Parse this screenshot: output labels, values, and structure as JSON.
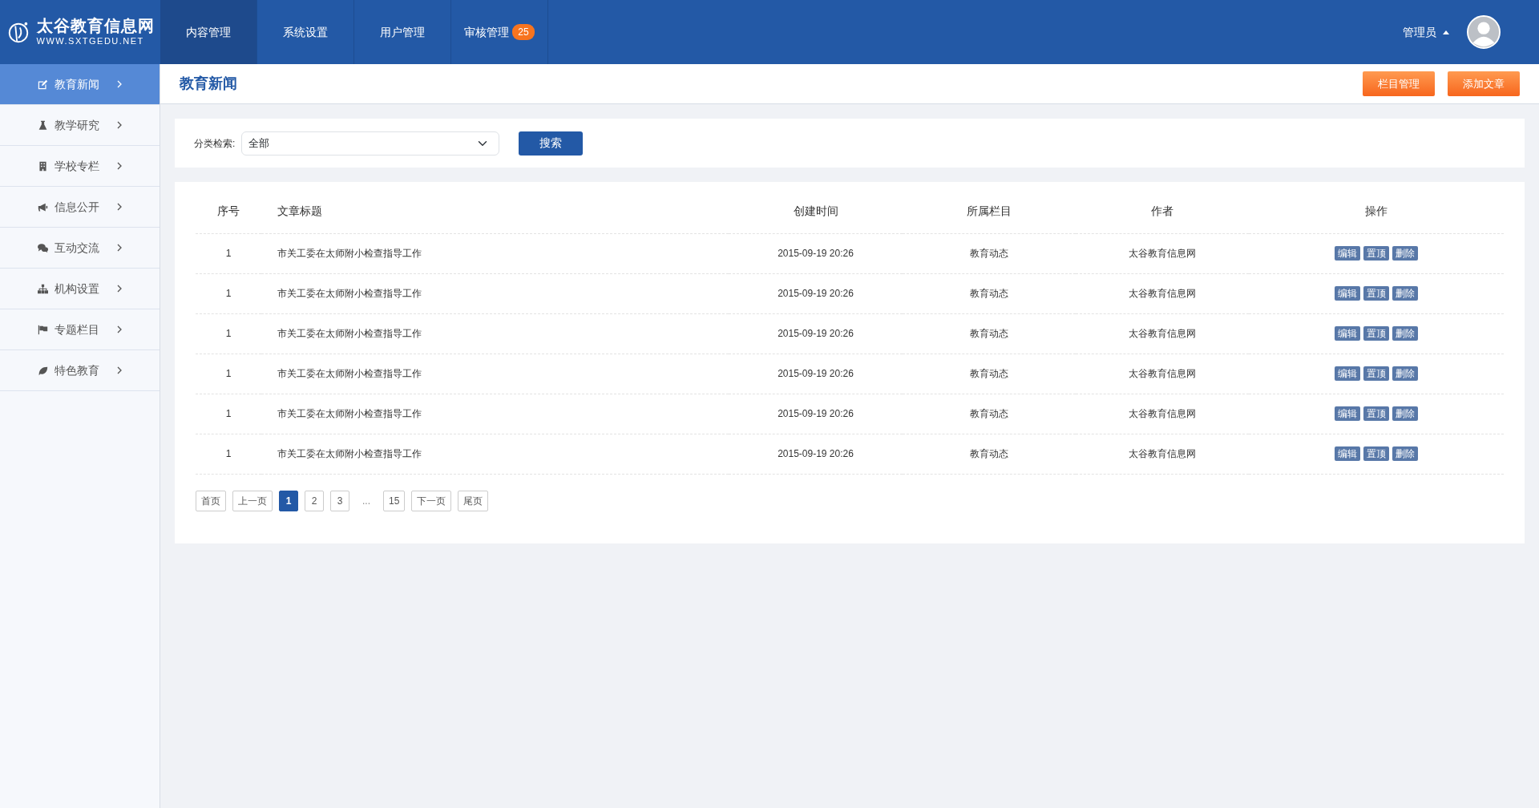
{
  "logo": {
    "title": "太谷教育信息网",
    "subtitle": "WWW.SXTGEDU.NET"
  },
  "top_nav": [
    {
      "label": "内容管理",
      "selected": true
    },
    {
      "label": "系统设置",
      "selected": false
    },
    {
      "label": "用户管理",
      "selected": false
    },
    {
      "label": "审核管理",
      "selected": false,
      "badge": "25"
    }
  ],
  "user": {
    "name": "管理员"
  },
  "sidebar": {
    "items": [
      {
        "label": "教育新闻",
        "selected": true
      },
      {
        "label": "教学研究",
        "selected": false
      },
      {
        "label": "学校专栏",
        "selected": false
      },
      {
        "label": "信息公开",
        "selected": false
      },
      {
        "label": "互动交流",
        "selected": false
      },
      {
        "label": "机构设置",
        "selected": false
      },
      {
        "label": "专题栏目",
        "selected": false
      },
      {
        "label": "特色教育",
        "selected": false
      }
    ]
  },
  "page": {
    "title": "教育新闻",
    "buttons": [
      "栏目管理",
      "添加文章"
    ]
  },
  "filter": {
    "label": "分类检索:",
    "value": "全部",
    "button": "搜索"
  },
  "table": {
    "columns": [
      "序号",
      "文章标题",
      "创建时间",
      "所属栏目",
      "作者",
      "操作"
    ],
    "rows": [
      {
        "cells": [
          "1",
          "市关工委在太师附小检查指导工作",
          "2015-09-19 20:26",
          "教育动态",
          "太谷教育信息网"
        ],
        "actions": [
          "编辑",
          "置顶",
          "删除"
        ]
      },
      {
        "cells": [
          "1",
          "市关工委在太师附小检查指导工作",
          "2015-09-19 20:26",
          "教育动态",
          "太谷教育信息网"
        ],
        "actions": [
          "编辑",
          "置顶",
          "删除"
        ]
      },
      {
        "cells": [
          "1",
          "市关工委在太师附小检查指导工作",
          "2015-09-19 20:26",
          "教育动态",
          "太谷教育信息网"
        ],
        "actions": [
          "编辑",
          "置顶",
          "删除"
        ]
      },
      {
        "cells": [
          "1",
          "市关工委在太师附小检查指导工作",
          "2015-09-19 20:26",
          "教育动态",
          "太谷教育信息网"
        ],
        "actions": [
          "编辑",
          "置顶",
          "删除"
        ]
      },
      {
        "cells": [
          "1",
          "市关工委在太师附小检查指导工作",
          "2015-09-19 20:26",
          "教育动态",
          "太谷教育信息网"
        ],
        "actions": [
          "编辑",
          "置顶",
          "删除"
        ]
      },
      {
        "cells": [
          "1",
          "市关工委在太师附小检查指导工作",
          "2015-09-19 20:26",
          "教育动态",
          "太谷教育信息网"
        ],
        "actions": [
          "编辑",
          "置顶",
          "删除"
        ]
      }
    ]
  },
  "pagination": [
    {
      "label": "首页",
      "kind": "link",
      "selected": false
    },
    {
      "label": "上一页",
      "kind": "link",
      "selected": false
    },
    {
      "label": "1",
      "kind": "link",
      "selected": true
    },
    {
      "label": "2",
      "kind": "link",
      "selected": false
    },
    {
      "label": "3",
      "kind": "link",
      "selected": false
    },
    {
      "label": "...",
      "kind": "ellipsis"
    },
    {
      "label": "15",
      "kind": "link",
      "selected": false
    },
    {
      "label": "下一页",
      "kind": "link",
      "selected": false
    },
    {
      "label": "尾页",
      "kind": "link",
      "selected": false
    }
  ]
}
